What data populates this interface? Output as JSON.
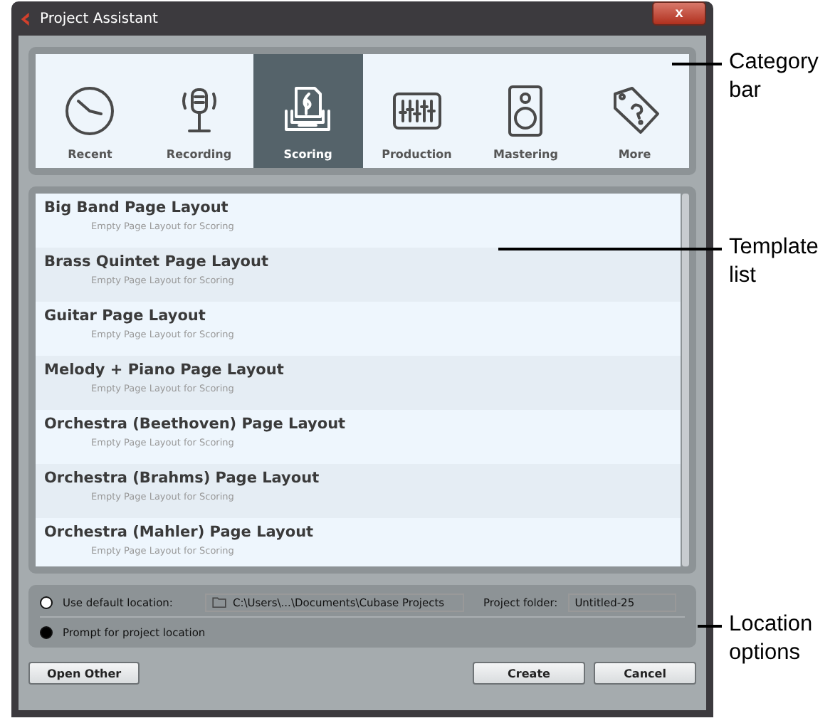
{
  "window": {
    "title": "Project Assistant",
    "close": "x"
  },
  "categories": [
    {
      "label": "Recent",
      "selected": false
    },
    {
      "label": "Recording",
      "selected": false
    },
    {
      "label": "Scoring",
      "selected": true
    },
    {
      "label": "Production",
      "selected": false
    },
    {
      "label": "Mastering",
      "selected": false
    },
    {
      "label": "More",
      "selected": false
    }
  ],
  "templates": [
    {
      "title": "Big Band Page Layout",
      "description": "Empty Page Layout for Scoring"
    },
    {
      "title": "Brass Quintet Page Layout",
      "description": "Empty Page Layout for Scoring"
    },
    {
      "title": "Guitar Page Layout",
      "description": "Empty Page Layout for Scoring"
    },
    {
      "title": "Melody + Piano Page Layout",
      "description": "Empty Page Layout for Scoring"
    },
    {
      "title": "Orchestra (Beethoven) Page Layout",
      "description": "Empty Page Layout for Scoring"
    },
    {
      "title": "Orchestra (Brahms) Page Layout",
      "description": "Empty Page Layout for Scoring"
    },
    {
      "title": "Orchestra (Mahler) Page Layout",
      "description": "Empty Page Layout for Scoring"
    }
  ],
  "location": {
    "options": [
      {
        "label": "Use default location:",
        "selected": false
      },
      {
        "label": "Prompt for project location",
        "selected": true
      }
    ],
    "path": "C:\\Users\\...\\Documents\\Cubase Projects",
    "folder_label": "Project folder:",
    "folder_value": "Untitled-25"
  },
  "buttons": {
    "left": [
      "Open Other"
    ],
    "right": [
      "Create",
      "Cancel"
    ]
  },
  "callouts": [
    {
      "text": "Category bar"
    },
    {
      "text": "Template list"
    },
    {
      "text": "Location options"
    }
  ]
}
